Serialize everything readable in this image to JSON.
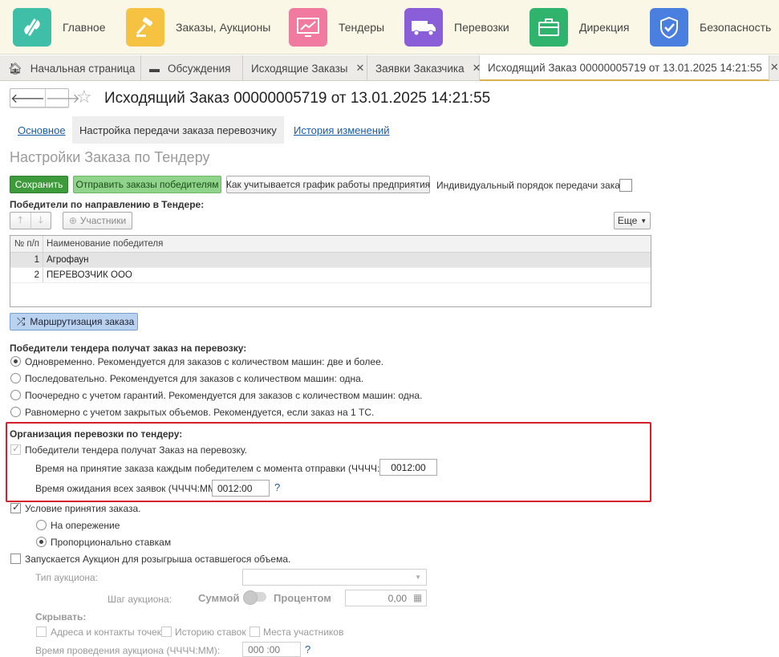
{
  "sections": [
    {
      "label": "Главное",
      "icon": "main-icon",
      "color": "#3fbfa8"
    },
    {
      "label": "Заказы, Аукционы",
      "icon": "auction-icon",
      "color": "#f5c242"
    },
    {
      "label": "Тендеры",
      "icon": "chart-icon",
      "color": "#f17aa0"
    },
    {
      "label": "Перевозки",
      "icon": "truck-icon",
      "color": "#8a5ed8"
    },
    {
      "label": "Дирекция",
      "icon": "briefcase-icon",
      "color": "#2fb36d"
    },
    {
      "label": "Безопасность",
      "icon": "shield-icon",
      "color": "#4a7fe0"
    }
  ],
  "tabs": [
    {
      "label": "Начальная страница"
    },
    {
      "label": "Обсуждения"
    },
    {
      "label": "Исходящие Заказы"
    },
    {
      "label": "Заявки Заказчика"
    },
    {
      "label": "Исходящий Заказ 00000005719 от 13.01.2025 14:21:55"
    }
  ],
  "title": "Исходящий Заказ 00000005719 от 13.01.2025 14:21:55",
  "subtabs": {
    "main": "Основное",
    "transfer": "Настройка передачи заказа перевозчику",
    "history": "История изменений"
  },
  "section_title": "Настройки Заказа по Тендеру",
  "toolbar": {
    "save": "Сохранить",
    "send": "Отправить заказы победителям",
    "schedule": "Как учитывается график работы предприятия",
    "individual_label": "Индивидуальный порядок передачи заказа:"
  },
  "winners": {
    "heading": "Победители по направлению в Тендере:",
    "participants_btn": "Участники",
    "more_btn": "Еще",
    "columns": [
      "№ п/п",
      "Наименование победителя"
    ],
    "rows": [
      {
        "n": "1",
        "name": "Агрофаун"
      },
      {
        "n": "2",
        "name": "ПЕРЕВОЗЧИК ООО"
      }
    ],
    "routing_btn": "Маршрутизация заказа"
  },
  "distribution": {
    "heading": "Победители тендера получат заказ на перевозку:",
    "options": [
      "Одновременно. Рекомендуется для заказов с количеством машин: две и более.",
      "Последовательно. Рекомендуется для заказов с количеством машин: одна.",
      "Поочередно с учетом гарантий. Рекомендуется для заказов с количеством машин: одна.",
      "Равномерно с учетом закрытых объемов. Рекомендуется, если заказ на 1 ТС."
    ],
    "selected_index": 0
  },
  "organization": {
    "heading": "Организация перевозки по тендеру:",
    "winners_receive": "Победители тендера получат Заказ на перевозку.",
    "accept_time_label": "Время на принятие заказа каждым победителем с момента отправки (ЧЧЧЧ:ММ):",
    "accept_time_value": "0012:00",
    "wait_time_label": "Время ожидания всех заявок (ЧЧЧЧ:ММ):",
    "wait_time_value": "0012:00",
    "help": "?"
  },
  "acceptance": {
    "label": "Условие принятия заказа.",
    "options": [
      "На опережение",
      "Пропорционально ставкам"
    ],
    "selected_index": 1
  },
  "auction": {
    "label": "Запускается Аукцион для розыгрыша оставшегося объема.",
    "type_label": "Тип аукциона:",
    "step_label": "Шаг аукциона:",
    "sum": "Суммой",
    "percent": "Процентом",
    "step_value": "0,00",
    "hide_label": "Скрывать:",
    "hide_options": [
      "Адреса и контакты точек",
      "Историю ставок",
      "Места участников"
    ],
    "duration_label": "Время проведения аукциона (ЧЧЧЧ:ММ):",
    "duration_value": "000 :00",
    "help": "?"
  }
}
